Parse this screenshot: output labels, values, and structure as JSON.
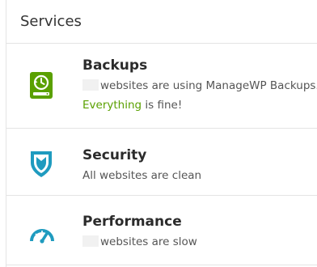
{
  "panel": {
    "title": "Services"
  },
  "services": {
    "backups": {
      "title": "Backups",
      "status_text": "websites are using ManageWP Backups.",
      "health_highlight": "Everything",
      "health_rest": " is fine!",
      "icon": "backup-drive-icon",
      "color": "#5aa000"
    },
    "security": {
      "title": "Security",
      "status_text": "All websites are clean",
      "icon": "shield-icon",
      "color": "#1f9bbf"
    },
    "performance": {
      "title": "Performance",
      "status_text": "websites are slow",
      "icon": "speedometer-icon",
      "color": "#1f9bbf"
    }
  }
}
